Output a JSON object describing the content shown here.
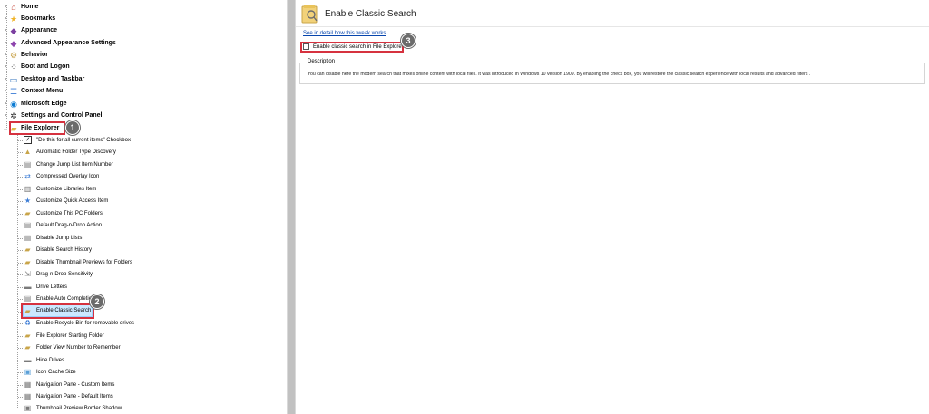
{
  "tree": {
    "top_items": [
      {
        "label": "Home",
        "icon": "home-icon"
      },
      {
        "label": "Bookmarks",
        "icon": "star-icon"
      },
      {
        "label": "Appearance",
        "icon": "palette-icon"
      },
      {
        "label": "Advanced Appearance Settings",
        "icon": "palette-icon"
      },
      {
        "label": "Behavior",
        "icon": "gear-icon"
      },
      {
        "label": "Boot and Logon",
        "icon": "loading-icon"
      },
      {
        "label": "Desktop and Taskbar",
        "icon": "monitor-icon"
      },
      {
        "label": "Context Menu",
        "icon": "menu-icon"
      },
      {
        "label": "Microsoft Edge",
        "icon": "edge-icon"
      },
      {
        "label": "Settings and Control Panel",
        "icon": "settings-icon"
      },
      {
        "label": "File Explorer",
        "icon": "folder-icon"
      }
    ],
    "file_explorer_children": [
      "\"Do this for all current items\" Checkbox",
      "Automatic Folder Type Discovery",
      "Change Jump List Item Number",
      "Compressed Overlay Icon",
      "Customize Libraries Item",
      "Customize Quick Access Item",
      "Customize This PC Folders",
      "Default Drag-n-Drop Action",
      "Disable Jump Lists",
      "Disable Search History",
      "Disable Thumbnail Previews for Folders",
      "Drag-n-Drop Sensitivity",
      "Drive Letters",
      "Enable Auto Completion",
      "Enable Classic Search",
      "Enable Recycle Bin for removable drives",
      "File Explorer Starting Folder",
      "Folder View Number to Remember",
      "Hide Drives",
      "Icon Cache Size",
      "Navigation Pane - Custom Items",
      "Navigation Pane - Default Items",
      "Thumbnail Preview Border Shadow"
    ]
  },
  "badges": {
    "one": "1",
    "two": "2",
    "three": "3"
  },
  "right": {
    "title": "Enable Classic Search",
    "detail_link": "See in detail how this tweak works",
    "checkbox_label": "Enable classic search in File Explorer",
    "checkbox_checked": false,
    "description_legend": "Description",
    "description_text": "You can disable here the modern search that mixes online content with local files. It was introduced in Windows 10 version 1909. By enabling the check box, you will restore the classic search experience with local results and advanced filters ."
  },
  "colors": {
    "highlight": "#d6323f",
    "selection": "#cce8ff",
    "link": "#0645ad"
  }
}
